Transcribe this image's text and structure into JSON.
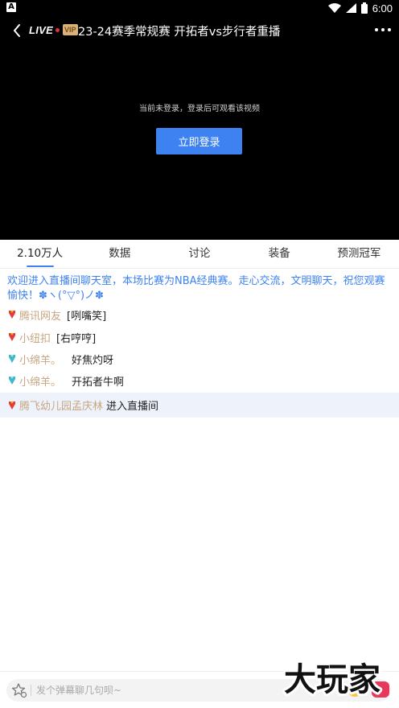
{
  "status_bar": {
    "time": "6:00",
    "notification_icon_letter": "A"
  },
  "player": {
    "live_label": "LIVE",
    "vip_label": "VIP",
    "title": "23-24赛季常规赛 开拓者vs步行者重播",
    "notice": "当前未登录，登录后可观看该视频",
    "login_button": "立即登录"
  },
  "tabs": [
    {
      "label": "2.10万人",
      "active": true
    },
    {
      "label": "数据",
      "active": false
    },
    {
      "label": "讨论",
      "active": false
    },
    {
      "label": "装备",
      "active": false
    },
    {
      "label": "预测冠军",
      "active": false
    }
  ],
  "chat": {
    "welcome": "欢迎进入直播间聊天室，本场比赛为NBA经典赛。走心交流，文明聊天，祝您观赛愉快！✽ヽ(°▽°)ノ✽",
    "messages": [
      {
        "user": "腾讯网友",
        "content": "[咧嘴笑]",
        "badge": "red"
      },
      {
        "user": "小纽扣",
        "content": "[右哼哼]",
        "badge": "red"
      },
      {
        "user": "小绵羊。",
        "content": "好焦灼呀",
        "badge": "teal"
      },
      {
        "user": "小绵羊。",
        "content": "开拓者牛啊",
        "badge": "teal"
      }
    ],
    "enter_message": {
      "user": "腾飞幼儿园孟庆林",
      "content": "进入直播间",
      "badge": "red"
    }
  },
  "bottom": {
    "placeholder": "发个弹幕聊几句呗~"
  },
  "watermark": "大玩家",
  "colors": {
    "accent": "#3d82f0",
    "username": "#c7a681",
    "enter_bg": "#eef3fb"
  }
}
